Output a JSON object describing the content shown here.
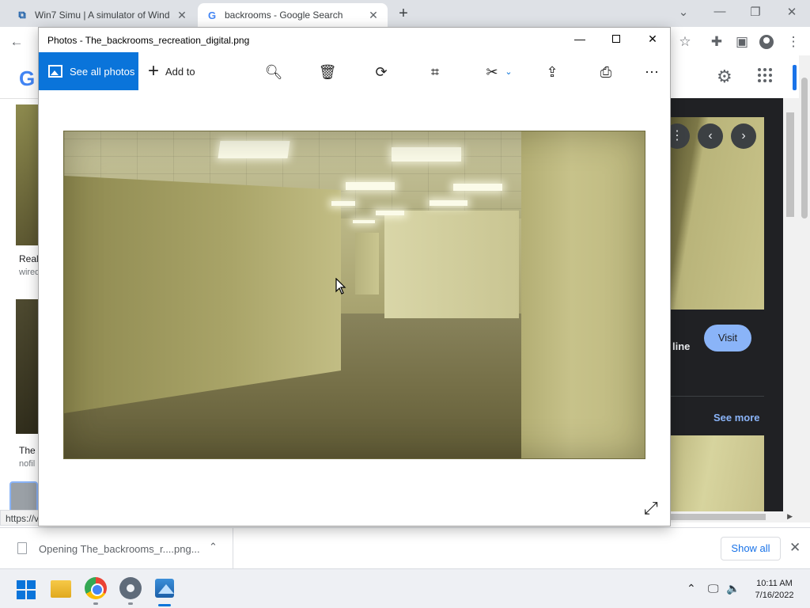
{
  "browser": {
    "tabs": [
      {
        "title": "Win7 Simu | A simulator of Wind",
        "favicon": "win7simu-icon",
        "active": false
      },
      {
        "title": "backrooms - Google Search",
        "favicon": "google-g-icon",
        "active": true
      }
    ],
    "new_tab_symbol": "+",
    "toolbar_icons": [
      "back-arrow-icon",
      "star-icon",
      "extensions-icon",
      "sidepanel-icon",
      "profile-icon",
      "menu-icon"
    ]
  },
  "google_page": {
    "logo_letter": "G",
    "results": [
      {
        "title": "Real",
        "source": "wired"
      },
      {
        "title": "The",
        "source": "nofil"
      }
    ],
    "preview": {
      "site_suffix": "line",
      "visit_label": "Visit",
      "see_more_label": "See more"
    },
    "status_url": "https://v"
  },
  "photos_app": {
    "window_title": "Photos - The_backrooms_recreation_digital.png",
    "see_all_label": "See all photos",
    "add_to_label": "Add to",
    "commands": [
      "zoom-icon",
      "delete-icon",
      "rotate-icon",
      "crop-icon",
      "edit-icon",
      "share-icon",
      "print-icon",
      "more-icon"
    ]
  },
  "download_bar": {
    "file_label": "Opening The_backrooms_r....png...",
    "show_all_label": "Show all"
  },
  "taskbar": {
    "apps": [
      "start-icon",
      "file-explorer-icon",
      "chrome-icon",
      "settings-icon",
      "photos-icon"
    ],
    "active_app": "photos-icon",
    "time": "10:11 AM",
    "date": "7/16/2022"
  },
  "colors": {
    "accent": "#0a74da",
    "google_blue": "#8ab4f8",
    "panel_dark": "#202124"
  }
}
